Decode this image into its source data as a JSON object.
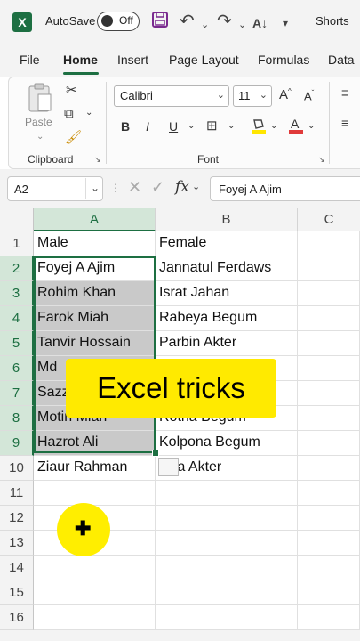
{
  "titlebar": {
    "app_icon": "excel-icon",
    "autosave_label": "AutoSave",
    "toggle_label": "Off",
    "file_name": "Shorts"
  },
  "tabs": [
    "File",
    "Home",
    "Insert",
    "Page Layout",
    "Formulas",
    "Data"
  ],
  "active_tab": "Home",
  "ribbon": {
    "clipboard": {
      "paste_label": "Paste",
      "group_label": "Clipboard"
    },
    "font": {
      "font_name": "Calibri",
      "font_size": "11",
      "group_label": "Font",
      "bold": "B",
      "italic": "I",
      "underline": "U"
    },
    "font_color": "#e03a3a",
    "fill_color": "#ffe600"
  },
  "formula_bar": {
    "name_box": "A2",
    "fx_label": "fx",
    "formula": "Foyej A Ajim"
  },
  "columns": [
    "A",
    "B",
    "C"
  ],
  "rows": [
    {
      "num": "1",
      "a": "Male",
      "b": "Female"
    },
    {
      "num": "2",
      "a": "Foyej A Ajim",
      "b": "Jannatul Ferdaws"
    },
    {
      "num": "3",
      "a": "Rohim Khan",
      "b": "Israt Jahan"
    },
    {
      "num": "4",
      "a": "Farok Miah",
      "b": "Rabeya Begum"
    },
    {
      "num": "5",
      "a": "Tanvir Hossain",
      "b": "Parbin Akter"
    },
    {
      "num": "6",
      "a": "Md",
      "b": ""
    },
    {
      "num": "7",
      "a": "Sazz",
      "b": ""
    },
    {
      "num": "8",
      "a": "Motin Miah",
      "b": "Rotna Begum"
    },
    {
      "num": "9",
      "a": "Hazrot Ali",
      "b": "Kolpona Begum"
    },
    {
      "num": "10",
      "a": "Ziaur Rahman",
      "b": "Liza Akter"
    },
    {
      "num": "11",
      "a": "",
      "b": ""
    },
    {
      "num": "12",
      "a": "",
      "b": ""
    },
    {
      "num": "13",
      "a": "",
      "b": ""
    },
    {
      "num": "14",
      "a": "",
      "b": ""
    },
    {
      "num": "15",
      "a": "",
      "b": ""
    },
    {
      "num": "16",
      "a": "",
      "b": ""
    }
  ],
  "overlay": {
    "banner_text": "Excel tricks"
  },
  "accent_color": "#1d6f42"
}
